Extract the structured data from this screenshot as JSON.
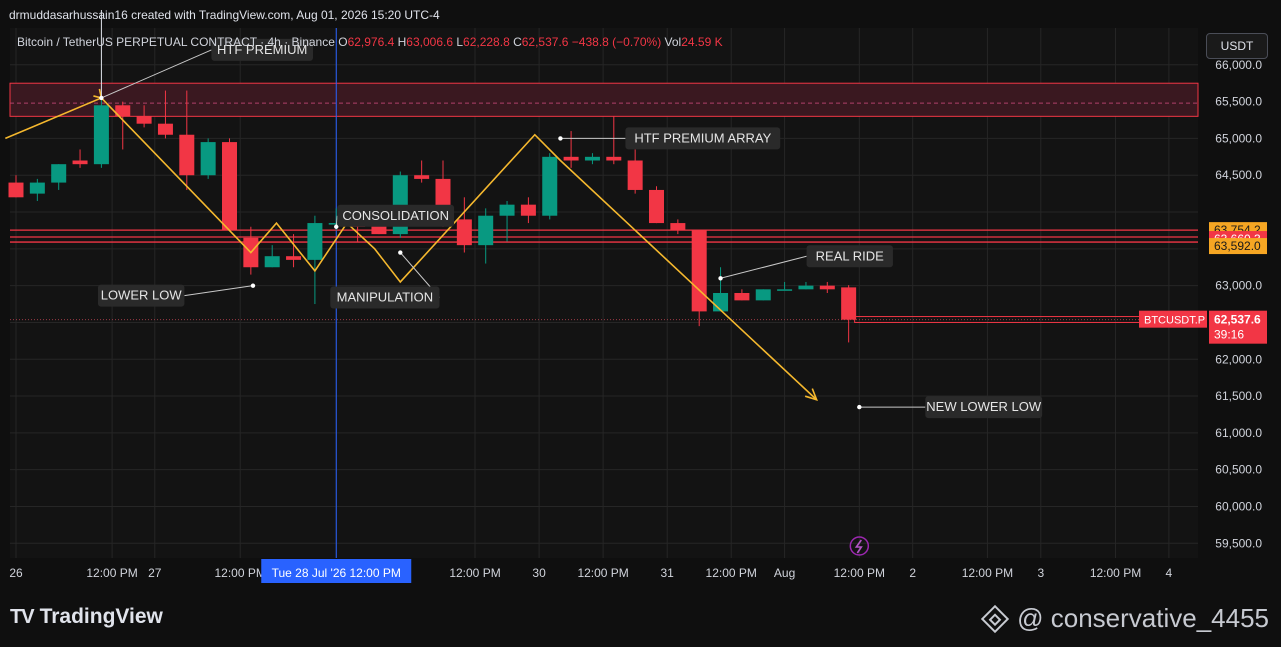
{
  "header": {
    "credit": "drmuddasarhussain16 created with TradingView.com, Aug 01, 2026 15:20 UTC-4",
    "symbol_line": "Bitcoin / TetherUS PERPETUAL CONTRACT · 4h · Binance",
    "ohlc": {
      "o_label": "O",
      "o_value": "62,976.4",
      "h_label": "H",
      "h_value": "63,006.6",
      "l_label": "L",
      "l_value": "62,228.8",
      "c_label": "C",
      "c_value": "62,537.6",
      "change": "−438.8 (−0.70%)",
      "vol_label": "Vol",
      "vol_value": "24.59 K"
    },
    "currency_button": "USDT"
  },
  "colors": {
    "background": "#131313",
    "up": "#089981",
    "down": "#f23645",
    "annotation_line": "#f5b82e",
    "zone_fill": "#3a1820",
    "zone_border": "#f23645",
    "axis_text": "#d1d4dc",
    "orange_badge": "#f6a623",
    "red_badge": "#f23645",
    "crosshair": "#2962ff"
  },
  "chart_data": {
    "type": "candlestick",
    "symbol": "BTCUSDT.P",
    "timeframe": "4h",
    "ylim": [
      59300,
      66500
    ],
    "y_ticks": [
      59500,
      60000,
      60500,
      61000,
      61500,
      62000,
      62500,
      63000,
      63500,
      64000,
      64500,
      65000,
      65500,
      66000
    ],
    "y_tick_labels": [
      "59,500.0",
      "60,000.0",
      "60,500.0",
      "61,000.0",
      "61,500.0",
      "62,000.0",
      "",
      "63,000.0",
      "",
      "",
      "64,500.0",
      "65,000.0",
      "65,500.0",
      "66,000.0"
    ],
    "x_labels": [
      "26",
      "12:00 PM",
      "27",
      "12:00 PM",
      "Tue 28 Jul '26   12:00 PM",
      "12:00 PM",
      "30",
      "12:00 PM",
      "31",
      "12:00 PM",
      "Aug",
      "12:00 PM",
      "2",
      "12:00 PM",
      "3",
      "12:00 PM",
      "4"
    ],
    "x_label_slots": [
      0,
      4.5,
      6.5,
      10.5,
      15,
      21.5,
      24.5,
      27.5,
      30.5,
      33.5,
      36,
      39.5,
      42,
      45.5,
      48,
      51.5,
      54
    ],
    "highlighted_x_label": "Tue 28 Jul '26   12:00 PM",
    "candles": [
      {
        "o": 64400,
        "h": 64500,
        "l": 64200,
        "c": 64200
      },
      {
        "o": 64250,
        "h": 64450,
        "l": 64150,
        "c": 64400
      },
      {
        "o": 64400,
        "h": 64650,
        "l": 64300,
        "c": 64650
      },
      {
        "o": 64700,
        "h": 64850,
        "l": 64600,
        "c": 64650
      },
      {
        "o": 64650,
        "h": 65550,
        "l": 64600,
        "c": 65450
      },
      {
        "o": 65450,
        "h": 65500,
        "l": 64850,
        "c": 65300
      },
      {
        "o": 65300,
        "h": 65450,
        "l": 65150,
        "c": 65200
      },
      {
        "o": 65200,
        "h": 65650,
        "l": 65000,
        "c": 65050
      },
      {
        "o": 65050,
        "h": 65650,
        "l": 64300,
        "c": 64500
      },
      {
        "o": 64500,
        "h": 65000,
        "l": 64450,
        "c": 64950
      },
      {
        "o": 64950,
        "h": 65000,
        "l": 63750,
        "c": 63750
      },
      {
        "o": 63650,
        "h": 63800,
        "l": 63150,
        "c": 63250
      },
      {
        "o": 63250,
        "h": 63550,
        "l": 63250,
        "c": 63400
      },
      {
        "o": 63400,
        "h": 63700,
        "l": 63250,
        "c": 63350
      },
      {
        "o": 63350,
        "h": 63950,
        "l": 62750,
        "c": 63850
      },
      {
        "o": 63850,
        "h": 64050,
        "l": 63750,
        "c": 63850
      },
      {
        "o": 63850,
        "h": 64000,
        "l": 63600,
        "c": 63800
      },
      {
        "o": 63850,
        "h": 64050,
        "l": 63700,
        "c": 63700
      },
      {
        "o": 63700,
        "h": 64550,
        "l": 63650,
        "c": 64500
      },
      {
        "o": 64500,
        "h": 64700,
        "l": 64400,
        "c": 64450
      },
      {
        "o": 64450,
        "h": 64700,
        "l": 63800,
        "c": 63900
      },
      {
        "o": 63900,
        "h": 64200,
        "l": 63450,
        "c": 63550
      },
      {
        "o": 63550,
        "h": 64050,
        "l": 63300,
        "c": 63950
      },
      {
        "o": 63950,
        "h": 64150,
        "l": 63600,
        "c": 64100
      },
      {
        "o": 64100,
        "h": 64200,
        "l": 63850,
        "c": 63950
      },
      {
        "o": 63950,
        "h": 64800,
        "l": 63900,
        "c": 64750
      },
      {
        "o": 64750,
        "h": 65100,
        "l": 64600,
        "c": 64700
      },
      {
        "o": 64700,
        "h": 64800,
        "l": 64650,
        "c": 64750
      },
      {
        "o": 64750,
        "h": 65300,
        "l": 64650,
        "c": 64700
      },
      {
        "o": 64700,
        "h": 64850,
        "l": 64250,
        "c": 64300
      },
      {
        "o": 64300,
        "h": 64350,
        "l": 63850,
        "c": 63850
      },
      {
        "o": 63850,
        "h": 63900,
        "l": 63700,
        "c": 63750
      },
      {
        "o": 63750,
        "h": 63750,
        "l": 62450,
        "c": 62650
      },
      {
        "o": 62650,
        "h": 63250,
        "l": 62650,
        "c": 62900
      },
      {
        "o": 62900,
        "h": 62950,
        "l": 62800,
        "c": 62800
      },
      {
        "o": 62800,
        "h": 62950,
        "l": 62800,
        "c": 62950
      },
      {
        "o": 62950,
        "h": 63050,
        "l": 62950,
        "c": 62950
      },
      {
        "o": 62950,
        "h": 63050,
        "l": 62950,
        "c": 63000
      },
      {
        "o": 63000,
        "h": 63050,
        "l": 62900,
        "c": 62950
      },
      {
        "o": 62976.4,
        "h": 63006.6,
        "l": 62228.8,
        "c": 62537.6
      }
    ],
    "horizontal_levels": [
      {
        "price": 63754.2,
        "label": "63,754.2",
        "badge": "orange"
      },
      {
        "price": 63660.3,
        "label": "63,660.3",
        "badge": "red"
      },
      {
        "price": 63592.0,
        "label": "63,592.0",
        "badge": "orange"
      }
    ],
    "current_price": {
      "ticker": "BTCUSDT.P",
      "price": 62537.6,
      "label": "62,537.6",
      "countdown": "39:16"
    },
    "zone": {
      "top": 65750,
      "bottom": 65300,
      "mid": 65480
    },
    "annotations": [
      {
        "text": "HTF PREMIUM",
        "anchor": {
          "slot": 4,
          "price": 65550
        }
      },
      {
        "text": "HTF PREMIUM  ARRAY",
        "anchor": {
          "slot": 25.5,
          "price": 65000
        }
      },
      {
        "text": "CONSOLIDATION",
        "anchor": {
          "slot": 15,
          "price": 63800
        }
      },
      {
        "text": "LOWER LOW",
        "anchor": {
          "slot": 11.1,
          "price": 63000
        }
      },
      {
        "text": "MANIPULATION",
        "anchor": {
          "slot": 18,
          "price": 63450
        }
      },
      {
        "text": "REAL RIDE",
        "anchor": {
          "slot": 33,
          "price": 63100
        }
      },
      {
        "text": "NEW LOWER LOW",
        "anchor": {
          "slot": 39.5,
          "price": 61350
        }
      }
    ],
    "zigzag": [
      {
        "slot": -0.5,
        "price": 65000
      },
      {
        "slot": 4,
        "price": 65550
      },
      {
        "slot": 11,
        "price": 63450
      },
      {
        "slot": 12.2,
        "price": 63850
      },
      {
        "slot": 14,
        "price": 63200
      },
      {
        "slot": 15.5,
        "price": 63850
      },
      {
        "slot": 16.8,
        "price": 63500
      },
      {
        "slot": 18,
        "price": 63050
      },
      {
        "slot": 24.3,
        "price": 65050
      },
      {
        "slot": 25.5,
        "price": 64700
      },
      {
        "slot": 37.5,
        "price": 61450
      }
    ]
  },
  "footer": {
    "brand": "TradingView",
    "brand_logo": "TV",
    "author": "@ conservative_4455"
  }
}
